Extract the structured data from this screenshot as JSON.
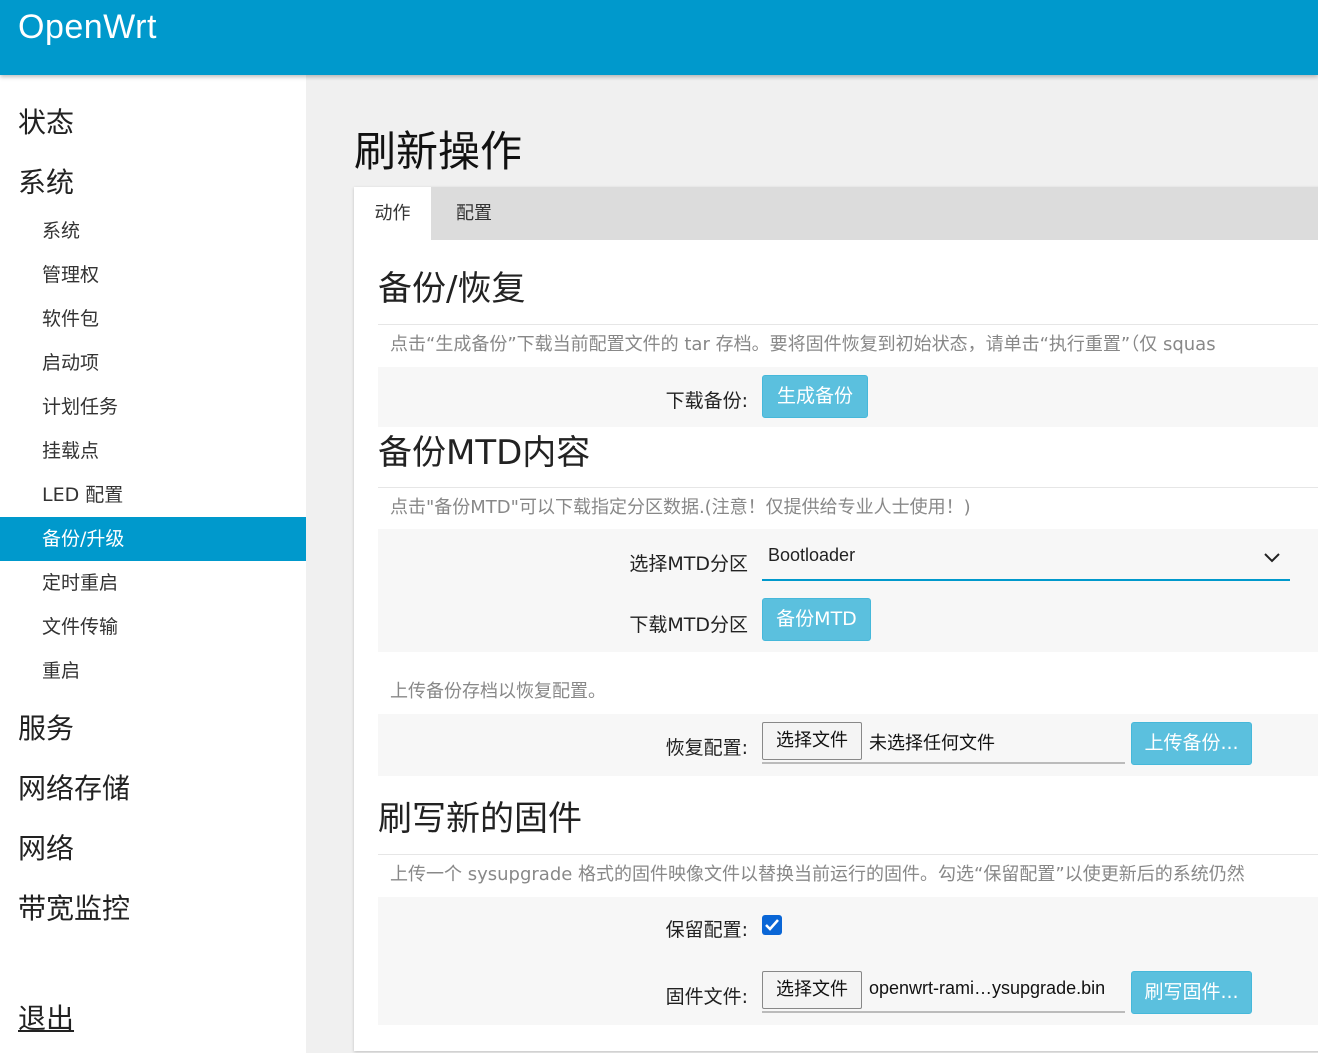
{
  "app": {
    "brand": "OpenWrt"
  },
  "sidebar": {
    "sections": [
      {
        "label": "状态"
      },
      {
        "label": "系统"
      }
    ],
    "system_items": [
      "系统",
      "管理权",
      "软件包",
      "启动项",
      "计划任务",
      "挂载点",
      "LED 配置",
      "备份/升级",
      "定时重启",
      "文件传输",
      "重启"
    ],
    "active_item": "备份/升级",
    "more_sections": [
      "服务",
      "网络存储",
      "网络",
      "带宽监控"
    ],
    "logout": "退出"
  },
  "page": {
    "title": "刷新操作",
    "tabs": [
      {
        "label": "动作",
        "active": true
      },
      {
        "label": "配置",
        "active": false
      }
    ]
  },
  "backup": {
    "title": "备份/恢复",
    "description": "点击“生成备份”下载当前配置文件的 tar 存档。要将固件恢复到初始状态，请单击“执行重置”（仅 squas",
    "download_label": "下载备份:",
    "generate_button": "生成备份"
  },
  "mtd": {
    "title": "备份MTD内容",
    "description": "点击\"备份MTD\"可以下载指定分区数据.(注意！仅提供给专业人士使用！)",
    "select_label": "选择MTD分区",
    "select_value": "Bootloader",
    "download_label": "下载MTD分区",
    "backup_button": "备份MTD"
  },
  "restore": {
    "description": "上传备份存档以恢复配置。",
    "label": "恢复配置:",
    "file_button": "选择文件",
    "file_name": "未选择任何文件",
    "upload_button": "上传备份..."
  },
  "flash": {
    "title": "刷写新的固件",
    "description": "上传一个 sysupgrade 格式的固件映像文件以替换当前运行的固件。勾选“保留配置”以使更新后的系统仍然",
    "keep_label": "保留配置:",
    "keep_checked": true,
    "file_label": "固件文件:",
    "file_button": "选择文件",
    "file_name": "openwrt-rami…ysupgrade.bin",
    "flash_button": "刷写固件..."
  },
  "colors": {
    "accent": "#0099cc",
    "button": "#5bc0de"
  },
  "icons": {
    "select": "chevron-down-icon",
    "checkbox": "checkmark-icon"
  }
}
